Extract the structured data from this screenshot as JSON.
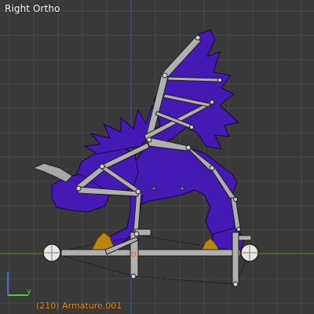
{
  "viewport": {
    "view_name": "Right Ortho",
    "frame_info": "(210) Armature.001",
    "axis_y_label": "y",
    "colors": {
      "background": "#393939",
      "grid_line": "#474747",
      "horizontal_axis": "#4e8a2a",
      "vertical_axis": "#3a52a6",
      "mesh_fill": "#4519b4",
      "mesh_edge": "#16063a",
      "bone": "#b0b0b0",
      "bone_outline": "#202020",
      "frame_text": "#ff8c00",
      "marker": "#b8860b"
    }
  }
}
